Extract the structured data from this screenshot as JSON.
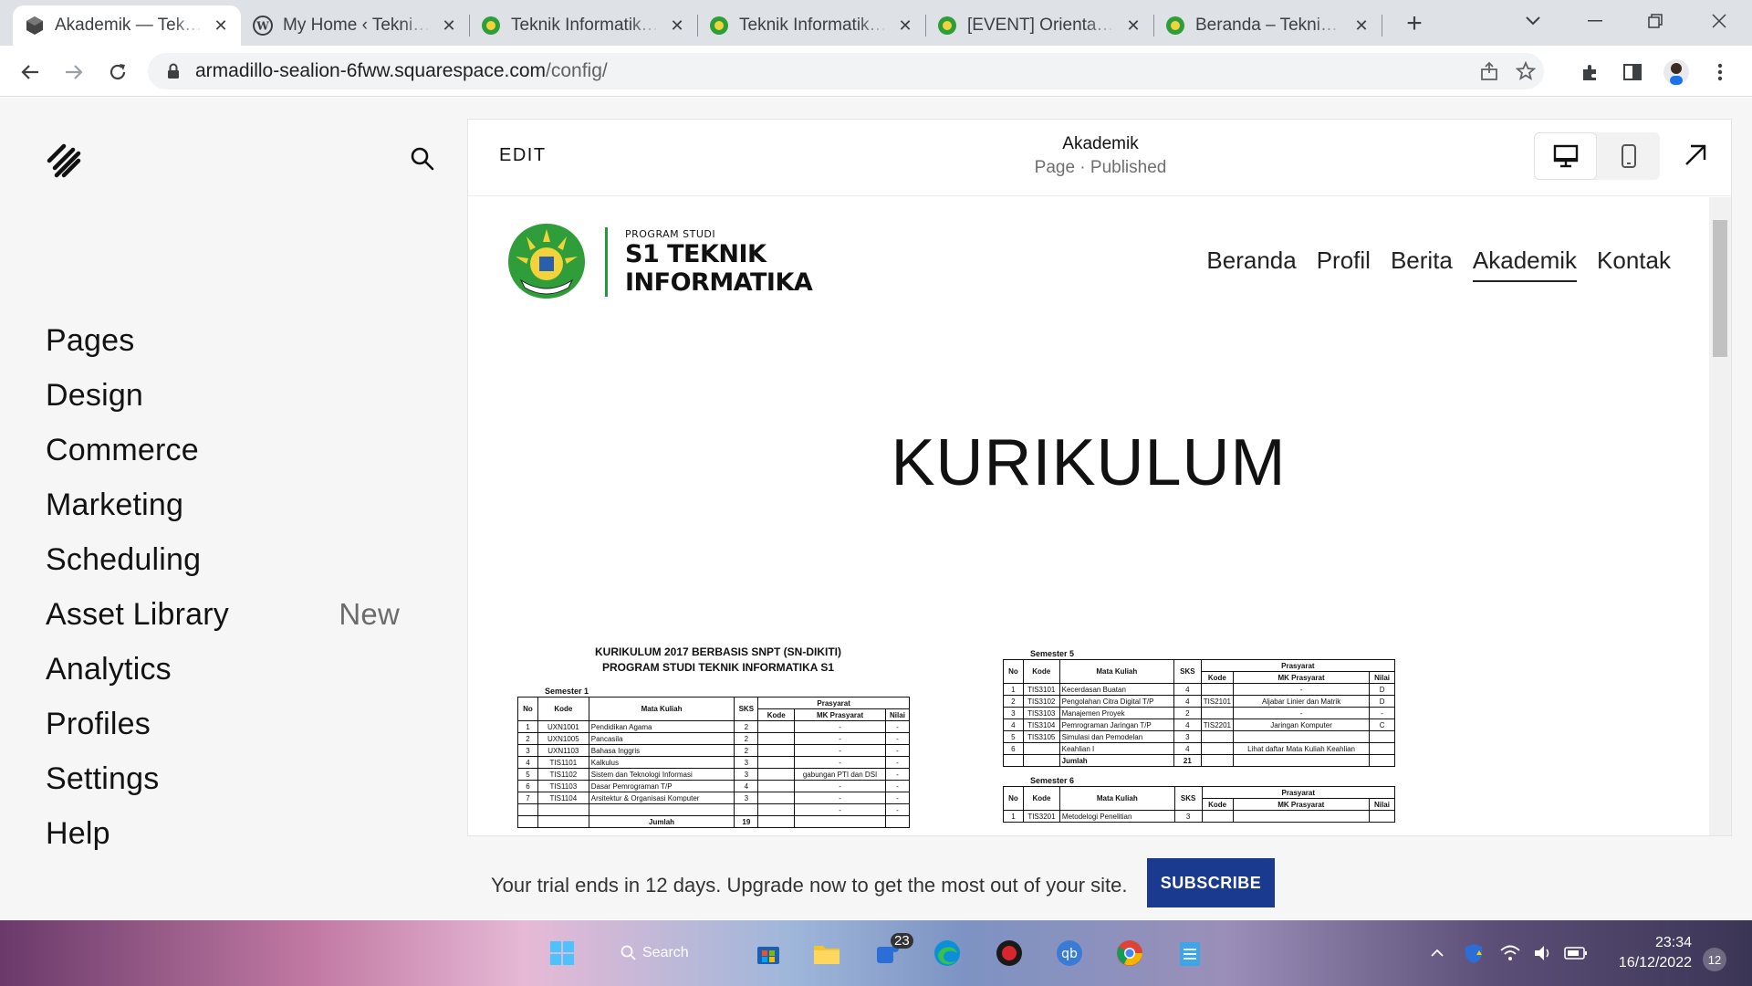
{
  "browser": {
    "tabs": [
      {
        "title": "Akademik — Teknik Informatika",
        "icon": "squarespace-cube-icon",
        "active": true
      },
      {
        "title": "My Home ‹ Teknik Informatika",
        "icon": "wordpress-icon",
        "active": false
      },
      {
        "title": "Teknik Informatika UMRAH",
        "icon": "umrah-logo-icon",
        "active": false
      },
      {
        "title": "Teknik Informatika UMRAH",
        "icon": "umrah-logo-icon",
        "active": false
      },
      {
        "title": "[EVENT] Orientasi Prodi",
        "icon": "umrah-logo-icon",
        "active": false
      },
      {
        "title": "Beranda – Teknik Informatika",
        "icon": "umrah-logo-icon",
        "active": false
      }
    ],
    "url_host": "armadillo-sealion-6fww.squarespace.com",
    "url_path": "/config/"
  },
  "sidebar": {
    "items": [
      {
        "label": "Pages",
        "badge": ""
      },
      {
        "label": "Design",
        "badge": ""
      },
      {
        "label": "Commerce",
        "badge": ""
      },
      {
        "label": "Marketing",
        "badge": ""
      },
      {
        "label": "Scheduling",
        "badge": ""
      },
      {
        "label": "Asset Library",
        "badge": "New"
      },
      {
        "label": "Analytics",
        "badge": ""
      },
      {
        "label": "Profiles",
        "badge": ""
      },
      {
        "label": "Settings",
        "badge": ""
      },
      {
        "label": "Help",
        "badge": ""
      }
    ]
  },
  "editor": {
    "edit_label": "EDIT",
    "page_title": "Akademik",
    "page_status": "Page · Published"
  },
  "site": {
    "logo_small": "PROGRAM STUDI",
    "logo_line1": "S1 TEKNIK",
    "logo_line2": "INFORMATIKA",
    "nav": [
      "Beranda",
      "Profil",
      "Berita",
      "Akademik",
      "Kontak"
    ],
    "nav_current": "Akademik",
    "hero": "KURIKULUM"
  },
  "doc_left": {
    "title1": "KURIKULUM 2017 BERBASIS SNPT (SN-DIKITI)",
    "title2": "PROGRAM STUDI TEKNIK INFORMATIKA S1",
    "semester": "Semester 1",
    "headers": {
      "no": "No",
      "kode": "Kode",
      "mk": "Mata Kuliah",
      "sks": "SKS",
      "prasyarat": "Prasyarat",
      "pkode": "Kode",
      "pmk": "MK Prasyarat",
      "nilai": "Nilai"
    },
    "rows": [
      {
        "no": "1",
        "kode": "UXN1001",
        "mk": "Pendidikan Agama",
        "sks": "2",
        "pkode": "",
        "pmk": "-",
        "nilai": "-"
      },
      {
        "no": "2",
        "kode": "UXN1005",
        "mk": "Pancasila",
        "sks": "2",
        "pkode": "",
        "pmk": "-",
        "nilai": "-"
      },
      {
        "no": "3",
        "kode": "UXN1103",
        "mk": "Bahasa Inggris",
        "sks": "2",
        "pkode": "",
        "pmk": "-",
        "nilai": "-"
      },
      {
        "no": "4",
        "kode": "TIS1101",
        "mk": "Kalkulus",
        "sks": "3",
        "pkode": "",
        "pmk": "-",
        "nilai": "-"
      },
      {
        "no": "5",
        "kode": "TIS1102",
        "mk": "Sistem dan Teknologi Informasi",
        "sks": "3",
        "pkode": "",
        "pmk": "gabungan PTI dan DSI",
        "nilai": "-"
      },
      {
        "no": "6",
        "kode": "TIS1103",
        "mk": "Dasar Pemrograman T/P",
        "sks": "4",
        "pkode": "",
        "pmk": "-",
        "nilai": "-"
      },
      {
        "no": "7",
        "kode": "TIS1104",
        "mk": "Arsitektur & Organisasi Komputer",
        "sks": "3",
        "pkode": "",
        "pmk": "-",
        "nilai": "-"
      },
      {
        "no": "",
        "kode": "",
        "mk": "",
        "sks": "",
        "pkode": "",
        "pmk": "-",
        "nilai": "-"
      }
    ],
    "jumlah_label": "Jumlah",
    "jumlah_value": "19"
  },
  "doc_right": {
    "semester5": "Semester 5",
    "headers": {
      "no": "No",
      "kode": "Kode",
      "mk": "Mata Kuliah",
      "sks": "SKS",
      "prasyarat": "Prasyarat",
      "pkode": "Kode",
      "pmk": "MK Prasyarat",
      "nilai": "Nilai"
    },
    "rows5": [
      {
        "no": "1",
        "kode": "TIS3101",
        "mk": "Kecerdasan Buatan",
        "sks": "4",
        "pkode": "",
        "pmk": "-",
        "nilai": "D"
      },
      {
        "no": "2",
        "kode": "TIS3102",
        "mk": "Pengolahan Citra Digital T/P",
        "sks": "4",
        "pkode": "TIS2101",
        "pmk": "Aljabar Linier dan Matrik",
        "nilai": "D"
      },
      {
        "no": "3",
        "kode": "TIS3103",
        "mk": "Manajemen Proyek",
        "sks": "2",
        "pkode": "",
        "pmk": "-",
        "nilai": "-"
      },
      {
        "no": "4",
        "kode": "TIS3104",
        "mk": "Pemrograman Jaringan T/P",
        "sks": "4",
        "pkode": "TIS2201",
        "pmk": "Jaringan Komputer",
        "nilai": "C"
      },
      {
        "no": "5",
        "kode": "TIS3105",
        "mk": "Simulasi dan Pemodelan",
        "sks": "3",
        "pkode": "",
        "pmk": "",
        "nilai": ""
      },
      {
        "no": "6",
        "kode": "",
        "mk": "Keahlian I",
        "sks": "4",
        "pkode": "",
        "pmk": "Lihat daftar Mata Kuliah Keahlian",
        "nilai": ""
      }
    ],
    "jumlah_label": "Jumlah",
    "jumlah_value": "21",
    "semester6": "Semester 6",
    "rows6": [
      {
        "no": "1",
        "kode": "TIS3201",
        "mk": "Metodelogi Penelitian",
        "sks": "3",
        "pkode": "",
        "pmk": "",
        "nilai": ""
      }
    ]
  },
  "trial": {
    "text": "Your trial ends in 12 days. Upgrade now to get the most out of your site.",
    "button": "SUBSCRIBE"
  },
  "taskbar": {
    "search_label": "Search",
    "badge_count": "23",
    "time": "23:34",
    "date": "16/12/2022",
    "notif_count": "12"
  },
  "colors": {
    "subscribe_bg": "#1a3a8f",
    "tabstrip_bg": "#dee1e6",
    "panel_bg": "#f6f6f6"
  }
}
